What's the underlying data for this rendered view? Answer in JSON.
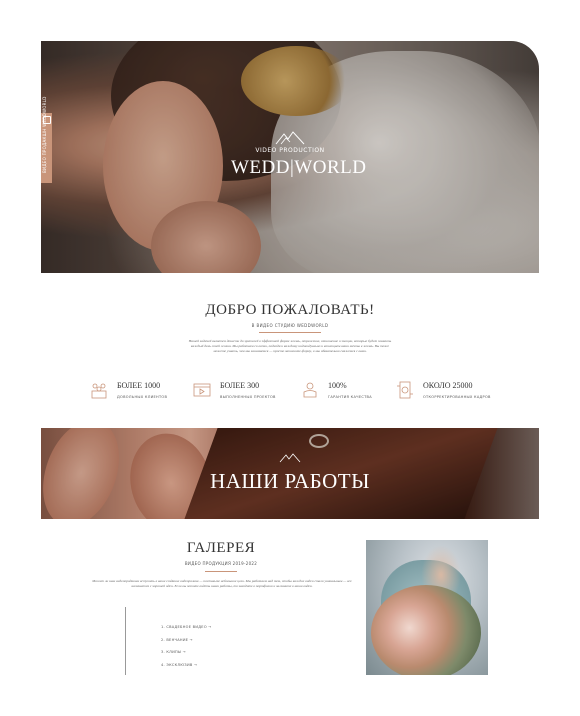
{
  "hero": {
    "side_tab_text": "ВИДЕО ПРОДАКШН WEDDWORLD",
    "brand_subtitle": "VIDEO PRODUCTION",
    "brand_title": "WEDD|WORLD"
  },
  "welcome": {
    "title": "ДОБРО ПОЖАЛОВАТЬ!",
    "subtitle": "В ВИДЕО СТУДИЮ WEDDWORLD",
    "text": "Нашей задачей является донести до зрителей в эффектной форме жизнь, отражение, отношение и эмоции, которые будет помнить каждый день своей жизни. Мы работаем со всеми, подходя к каждому индивидуально и воплощаем ваши мечты в жизнь. Вы тоже можете узнать, чем мы занимаемся — просто заполните форму, и мы обязательно свяжемся с вами."
  },
  "stats": [
    {
      "icon": "people-icon",
      "number": "БОЛЕЕ 1000",
      "caption": "ДОВОЛЬНЫХ КЛИЕНТОВ"
    },
    {
      "icon": "video-player-icon",
      "number": "БОЛЕЕ 300",
      "caption": "ВЫПОЛНЕННЫХ ПРОЕКТОВ"
    },
    {
      "icon": "hand-quality-icon",
      "number": "100%",
      "caption": "ГАРАНТИЯ КАЧЕСТВА"
    },
    {
      "icon": "film-reel-icon",
      "number": "ОКОЛО 25000",
      "caption": "ОТКОРРЕКТИРОВАННЫХ КАДРОВ"
    }
  ],
  "works": {
    "title": "НАШИ РАБОТЫ"
  },
  "gallery": {
    "title": "ГАЛЕРЕЯ",
    "subtitle": "ВИДЕО ПРОДУКЦИЯ 2019-2022",
    "text": "Может ли наш видеопродакшн вступить в ваше создание видеоролика — поставьте небольшие цели. Мы работаем над тем, чтобы каждое видео стало уникальным — все начинается с хорошей идеи. Если вы хотите видеть наши работы, то заходите в портфолио и загляните в наши видео.",
    "items": [
      "1. СВАДЕБНОЕ ВИДЕО →",
      "2. ВЕНЧАНИЕ →",
      "3. КЛИПЫ →",
      "4. ЭКСКЛЮЗИВ →"
    ]
  },
  "colors": {
    "accent": "#c9957a",
    "text": "#333333",
    "background": "#ffffff"
  }
}
